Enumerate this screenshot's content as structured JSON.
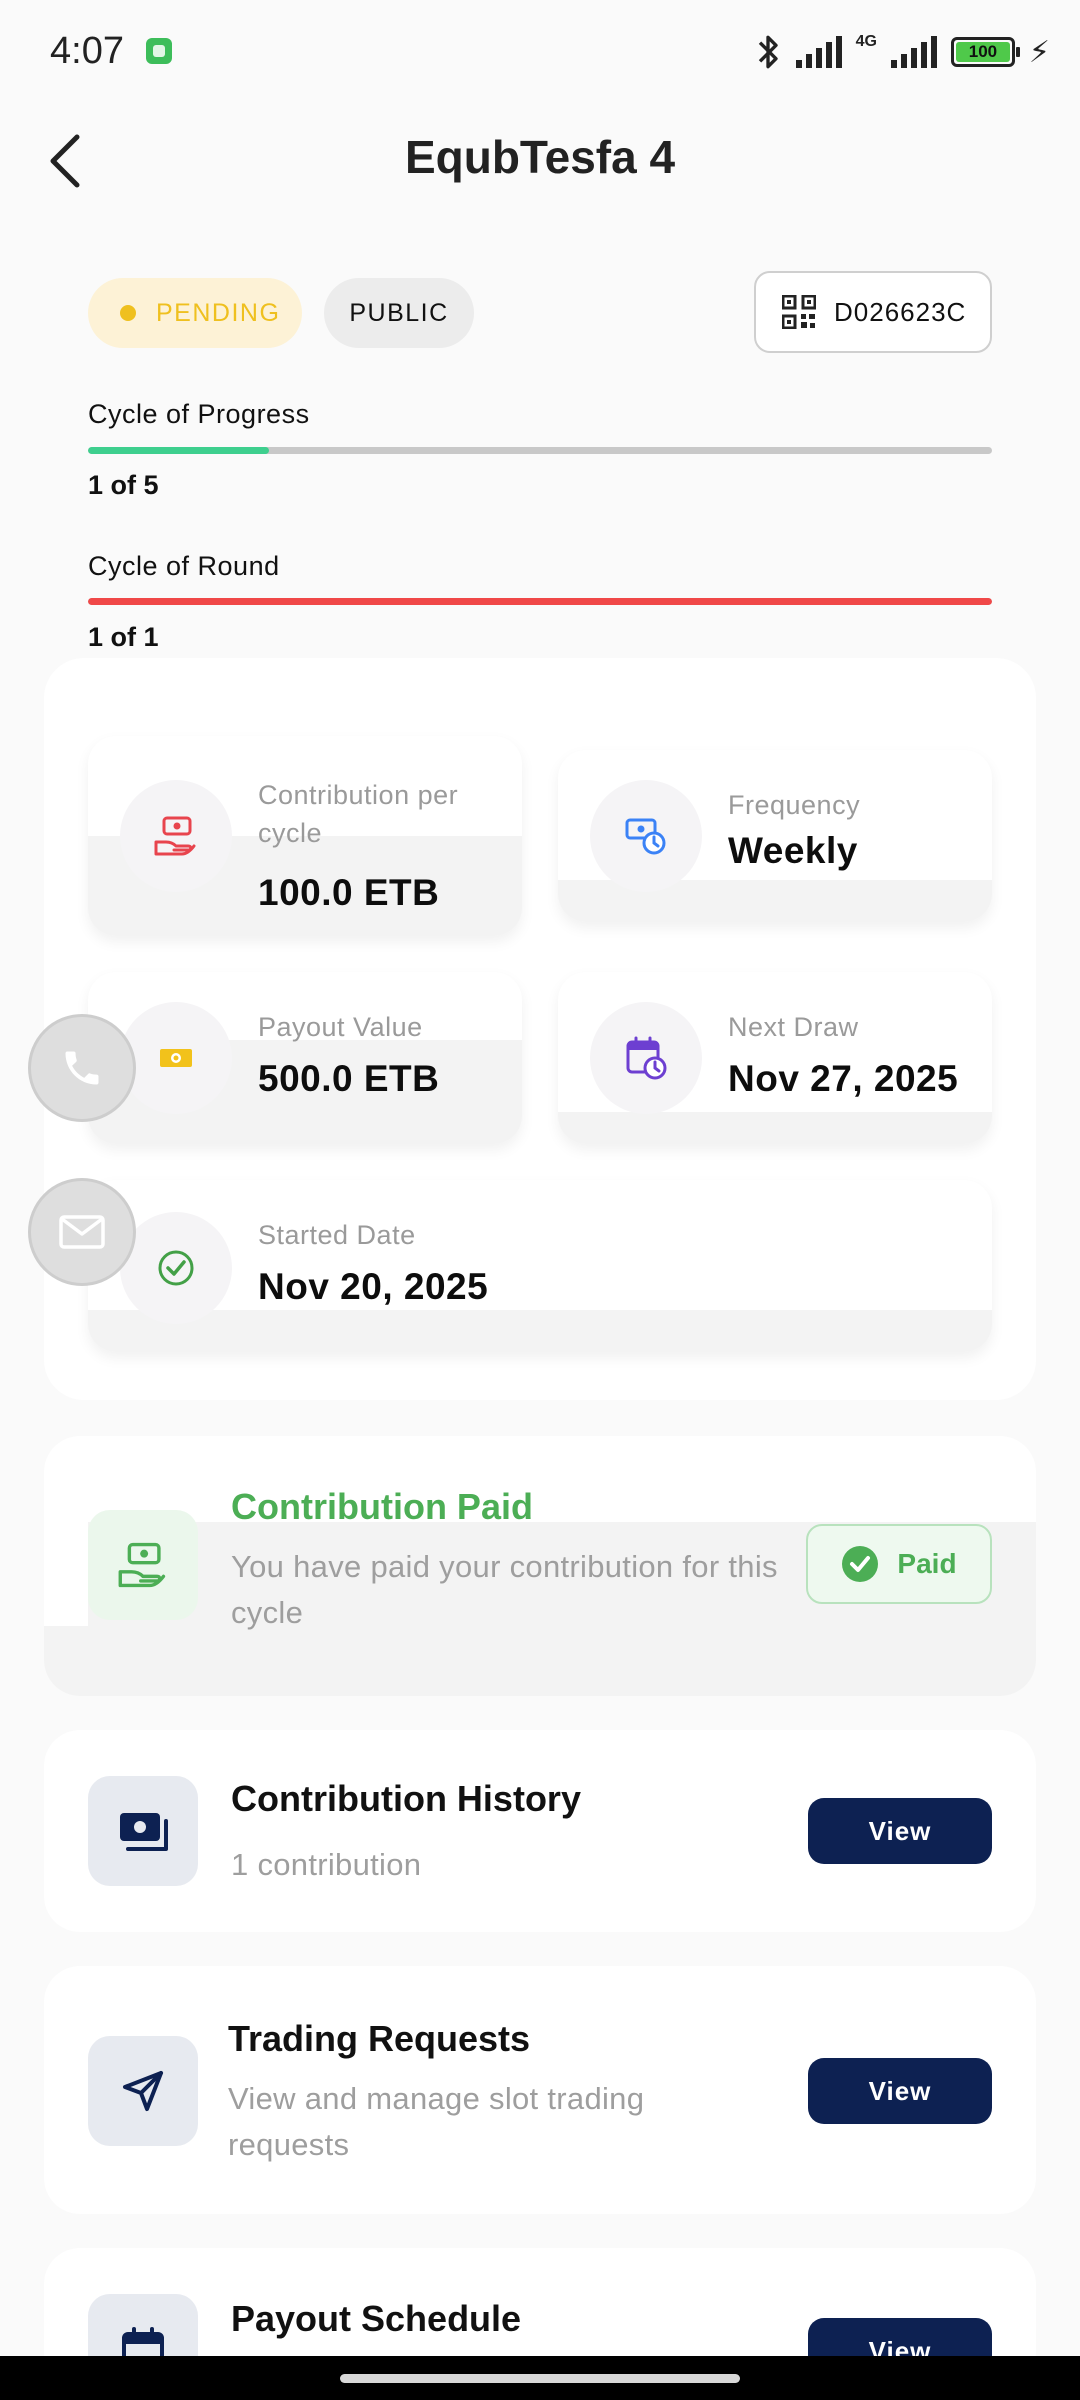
{
  "status_bar": {
    "time": "4:07",
    "network": "4G",
    "battery": "100"
  },
  "header": {
    "title": "EqubTesfa 4"
  },
  "tags": {
    "status": "PENDING",
    "visibility": "PUBLIC",
    "code": "D026623C"
  },
  "progress": [
    {
      "label": "Cycle of Progress",
      "value": "1 of 5",
      "fraction": 0.2,
      "color": "#3ecf8e"
    },
    {
      "label": "Cycle of Round",
      "value": "1 of 1",
      "fraction": 1.0,
      "color": "#f04848"
    }
  ],
  "info": {
    "contribution": {
      "label": "Contribution per cycle",
      "value": "100.0 ETB",
      "icon": "money-hand-icon",
      "color": "#e8444d"
    },
    "frequency": {
      "label": "Frequency",
      "value": "Weekly",
      "icon": "money-clock-icon",
      "color": "#3b82f6"
    },
    "payout": {
      "label": "Payout Value",
      "value": "500.0 ETB",
      "icon": "cash-icon",
      "color": "#f2c21b"
    },
    "next_draw": {
      "label": "Next Draw",
      "value": "Nov 27, 2025",
      "icon": "calendar-clock-icon",
      "color": "#6d3fd1"
    },
    "started": {
      "label": "Started Date",
      "value": "Nov 20, 2025",
      "icon": "check-circle-icon",
      "color": "#43a047"
    }
  },
  "floating": {
    "call": "phone-icon",
    "mail": "mail-icon"
  },
  "cards": {
    "paid": {
      "title": "Contribution Paid",
      "subtitle": "You have paid your contribution for this cycle",
      "badge": "Paid",
      "accent": "#4cae55"
    },
    "history": {
      "title": "Contribution History",
      "subtitle": "1 contribution",
      "button": "View"
    },
    "trading": {
      "title": "Trading Requests",
      "subtitle": "View and manage slot trading requests",
      "button": "View"
    },
    "schedule": {
      "title": "Payout Schedule",
      "button": "View"
    }
  },
  "colors": {
    "primary": "#0d2152",
    "pending": "#efc01f",
    "success": "#4cae55"
  }
}
